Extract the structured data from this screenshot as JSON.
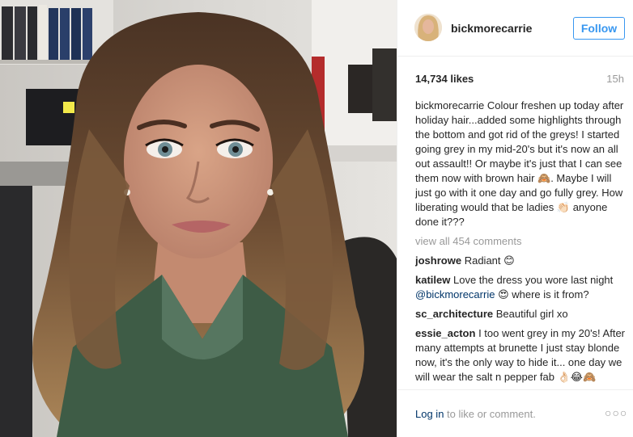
{
  "post": {
    "username": "bickmorecarrie",
    "follow_label": "Follow",
    "likes": "14,734 likes",
    "time": "15h",
    "caption_user": "bickmorecarrie",
    "caption_text": "Colour freshen up today after holiday hair...added some highlights through the bottom and got rid of the greys! I started going grey in my mid-20's but it's now an all out assault!! Or maybe it's just that I can see them now with brown hair 🙈. Maybe I will just go with it one day and go fully grey. How liberating would that be ladies 👏🏻 anyone done it???",
    "view_all": "view all 454 comments"
  },
  "comments": [
    {
      "user": "joshrowe",
      "text": "Radiant 😊"
    },
    {
      "user": "katilew",
      "text_before": "Love the dress you wore last night ",
      "mention": "@bickmorecarrie",
      "text_after": " 😍 where is it from?"
    },
    {
      "user": "sc_architecture",
      "text": "Beautiful girl xo"
    },
    {
      "user": "essie_acton",
      "text": "I too went grey in my 20's! After many attempts at brunette I just stay blonde now, it's the only way to hide it... one day we will wear the salt n pepper fab 👌🏻😂🙈"
    }
  ],
  "footer": {
    "login_link": "Log in",
    "login_rest": " to like or comment.",
    "more_icon": "more-dots-icon"
  },
  "colors": {
    "accent": "#3897f0",
    "link": "#003569",
    "muted": "#999999",
    "text": "#262626"
  }
}
